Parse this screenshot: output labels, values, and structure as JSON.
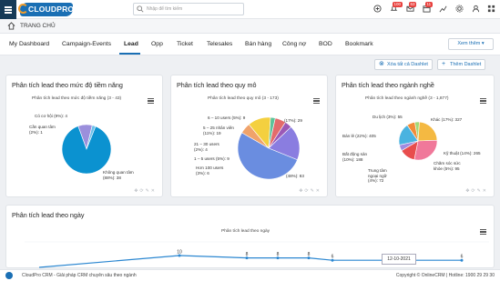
{
  "header": {
    "logo_text": "CLOUDPRO",
    "search_placeholder": "Nhập để tìm kiếm",
    "badges": {
      "notifications": "100",
      "messages": "63",
      "tasks": "11"
    },
    "icons": [
      "plus-icon",
      "bell-icon",
      "mail-icon",
      "calendar-icon",
      "chart-icon",
      "settings-icon",
      "user-icon",
      "grid-icon"
    ]
  },
  "titlebar": {
    "title": "TRANG CHỦ"
  },
  "tabs": [
    {
      "label": "My Dashboard"
    },
    {
      "label": "Campaign-Events"
    },
    {
      "label": "Lead"
    },
    {
      "label": "Opp"
    },
    {
      "label": "Ticket"
    },
    {
      "label": "Telesales"
    },
    {
      "label": "Bán hàng"
    },
    {
      "label": "Công nợ"
    },
    {
      "label": "BOD"
    },
    {
      "label": "Bookmark"
    }
  ],
  "active_tab": "Lead",
  "more_label": "Xem thêm",
  "actions": {
    "delete_all": "Xóa tất cả Dashlet",
    "add": "Thêm Dashlet"
  },
  "dashlets": {
    "potential": {
      "title": "Phân tích lead theo mức độ tiềm năng",
      "chart_title": "Phân tích lead theo mức độ tiềm năng (3 - 43)",
      "labels": [
        "Có cơ hội (9%): 4",
        "Cần quan tâm (2%): 1",
        "Không quan tâm (88%): 38"
      ]
    },
    "scale": {
      "title": "Phân tích lead theo quy mô",
      "chart_title": "Phân tích lead theo quy mô (3 - 173)",
      "labels": [
        "6 – 10 users (5%): 9",
        "5 – 25 nhân viên (11%): 19",
        "21 – 30 users (2%): 4",
        "1 – 5 users (5%): 9",
        "Hơn 100 users (3%): 6",
        "(17%): 29",
        "(48%): 83"
      ]
    },
    "industry": {
      "title": "Phân tích lead theo ngành nghề",
      "chart_title": "Phân tích lead theo ngành nghề (3 - 1,877)",
      "labels": [
        "Du lịch (3%): 55",
        "Khác (17%): 327",
        "Bán lẻ (22%): 405",
        "Bất động sản (10%): 188",
        "Trung tâm ngoại ngữ (4%): 72",
        "Kỹ thuật (14%): 265",
        "Chăm sóc sức khỏe (5%): 95"
      ]
    },
    "by_day": {
      "title": "Phân tích lead theo ngày",
      "chart_title": "Phân tích lead theo ngày",
      "tooltip": "12-10-2021",
      "points": [
        "10",
        "8",
        "8",
        "8",
        "6",
        "6"
      ]
    }
  },
  "chart_data": [
    {
      "type": "pie",
      "title": "Phân tích lead theo mức độ tiềm năng (3 - 43)",
      "categories": [
        "Có cơ hội",
        "Cần quan tâm",
        "Không quan tâm"
      ],
      "values": [
        4,
        1,
        38
      ],
      "colors": [
        "#9b8fdc",
        "#6bc0ea",
        "#0b92d0"
      ]
    },
    {
      "type": "pie",
      "title": "Phân tích lead theo quy mô (3 - 173)",
      "categories": [
        "6 – 10 users",
        "5 – 25 nhân viên",
        "21 – 30 users",
        "1 – 5 users",
        "Hơn 100 users",
        "",
        ""
      ],
      "values": [
        9,
        19,
        4,
        9,
        6,
        29,
        83
      ],
      "colors": [
        "#f0a36b",
        "#f4d03f",
        "#5cc39a",
        "#e36b6b",
        "#9b59b6",
        "#8a7de0",
        "#6a8de0"
      ]
    },
    {
      "type": "pie",
      "title": "Phân tích lead theo ngành nghề (3 - 1,877)",
      "categories": [
        "Du lịch",
        "Khác",
        "Bán lẻ",
        "Bất động sản",
        "Trung tâm ngoại ngữ",
        "Kỹ thuật",
        "Chăm sóc sức khỏe"
      ],
      "values": [
        55,
        327,
        405,
        188,
        72,
        265,
        95
      ],
      "colors": [
        "#a3d977",
        "#f4b942",
        "#f0789a",
        "#e84d4d",
        "#a18be0",
        "#4ab3e0",
        "#f28c38"
      ]
    },
    {
      "type": "line",
      "title": "Phân tích lead theo ngày",
      "values": [
        10,
        8,
        8,
        8,
        6,
        6
      ]
    }
  ]
}
